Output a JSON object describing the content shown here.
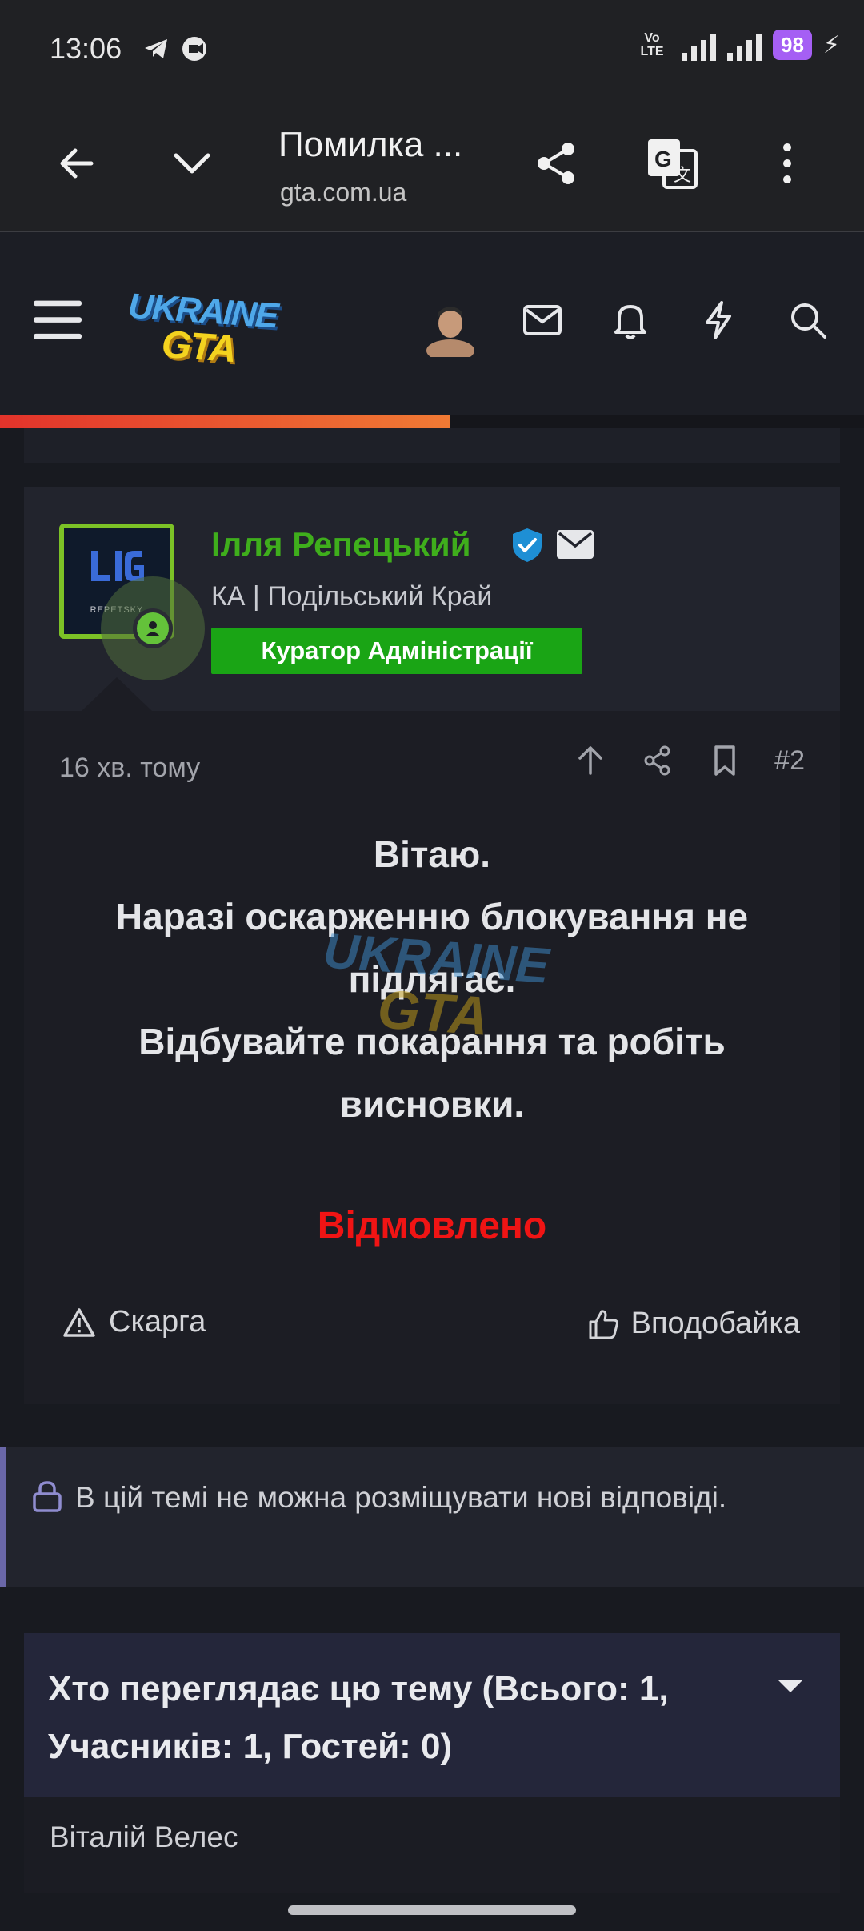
{
  "status_bar": {
    "time": "13:06",
    "network": "VoLTE",
    "network_type": "4G",
    "battery": "98",
    "icons": [
      "telegram-icon",
      "radio-icon",
      "volte-icon",
      "signal-icon",
      "battery-icon",
      "charging-icon"
    ]
  },
  "browser": {
    "title": "Помилка ...",
    "url": "gta.com.ua",
    "icons": [
      "back-arrow-icon",
      "chevron-down-icon",
      "share-icon",
      "translate-icon",
      "more-vert-icon"
    ]
  },
  "site_header": {
    "logo_top": "UKRAINE",
    "logo_bottom": "GTA",
    "icons": [
      "menu-icon",
      "mail-icon",
      "bell-icon",
      "lightning-icon",
      "search-icon"
    ],
    "read_progress": 0.52,
    "progress_colors": [
      "#e2332b",
      "#f07a34"
    ]
  },
  "post": {
    "author": {
      "name": "Ілля Репецький",
      "avatar_tag": "REPETSKY",
      "subtitle": "КА | Подільський Край",
      "badge": "Куратор Адміністрації",
      "name_color": "#3fae1c",
      "badge_color": "#1aa515"
    },
    "time": "16 хв. тому",
    "number": "#2",
    "lines": [
      "Вітаю.",
      "Наразі оскарженню блокування не підлягає.",
      "Відбувайте покарання та робіть висновки."
    ],
    "verdict": "Відмовлено",
    "verdict_color": "#f01414",
    "report_label": "Скарга",
    "like_label": "Вподобайка"
  },
  "locked_notice": {
    "text": "В цій темі не можна розміщувати нові відповіді."
  },
  "viewing": {
    "title": "Хто переглядає цю тему (Всього: 1, Учасників: 1, Гостей: 0)",
    "users": [
      "Віталій Велес"
    ]
  }
}
